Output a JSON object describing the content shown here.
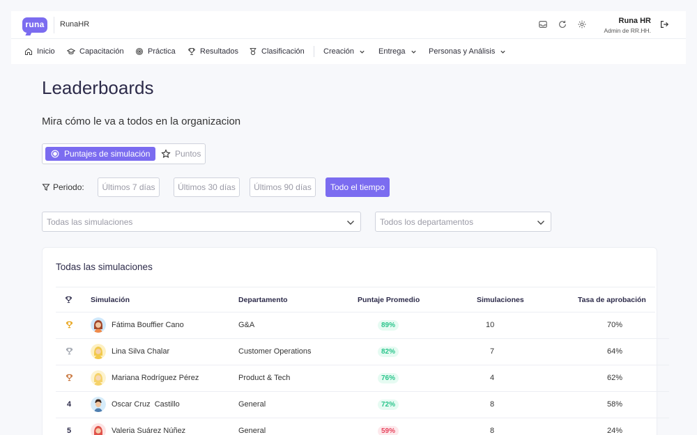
{
  "header": {
    "logo_text": "runa",
    "company": "RunaHR",
    "user_name": "Runa HR",
    "user_role": "Admin de RR.HH."
  },
  "nav": {
    "items": [
      {
        "label": "Inicio",
        "icon": "home-icon"
      },
      {
        "label": "Capacitación",
        "icon": "graduation-cap-icon"
      },
      {
        "label": "Práctica",
        "icon": "target-icon"
      },
      {
        "label": "Resultados",
        "icon": "trophy-icon"
      },
      {
        "label": "Clasificación",
        "icon": "medal-icon"
      },
      {
        "label": "Creación",
        "dropdown": true
      },
      {
        "label": "Entrega",
        "dropdown": true
      },
      {
        "label": "Personas y Análisis",
        "dropdown": true
      }
    ]
  },
  "page": {
    "title": "Leaderboards",
    "subtitle": "Mira cómo le va a todos en la organizacion"
  },
  "toggle": {
    "active": "Puntajes de simulación",
    "other": "Puntos"
  },
  "period": {
    "label": "Periodo:",
    "options": [
      "Últimos 7 días",
      "Últimos 30 días",
      "Últimos 90 días",
      "Todo el tiempo"
    ],
    "selected": "Todo el tiempo"
  },
  "filters": {
    "simulations_placeholder": "Todas las simulaciones",
    "departments_placeholder": "Todos los departamentos"
  },
  "table": {
    "title": "Todas las simulaciones",
    "columns": [
      "Simulación",
      "Departamento",
      "Puntaje Promedio",
      "Simulaciones",
      "Tasa de aprobación"
    ],
    "rows": [
      {
        "rank": "",
        "medal": "gold",
        "name": "Fátima Bouffier Cano",
        "department": "G&A",
        "score": "89%",
        "score_status": "good",
        "simulations": "10",
        "pass_rate": "70%"
      },
      {
        "rank": "",
        "medal": "silver",
        "name": "Lina Silva Chalar",
        "department": "Customer Operations",
        "score": "82%",
        "score_status": "good",
        "simulations": "7",
        "pass_rate": "64%"
      },
      {
        "rank": "",
        "medal": "bronze",
        "name": "Mariana Rodríguez Pérez",
        "department": "Product & Tech",
        "score": "76%",
        "score_status": "good",
        "simulations": "4",
        "pass_rate": "62%"
      },
      {
        "rank": "4",
        "medal": "",
        "name": "Oscar Cruz  Castillo",
        "department": "General",
        "score": "72%",
        "score_status": "good",
        "simulations": "8",
        "pass_rate": "58%"
      },
      {
        "rank": "5",
        "medal": "",
        "name": "Valeria Suárez Núñez",
        "department": "General",
        "score": "59%",
        "score_status": "bad",
        "simulations": "8",
        "pass_rate": "24%"
      }
    ]
  },
  "colors": {
    "accent": "#7b6cf0",
    "good": "#2ac48b",
    "bad": "#e7455f",
    "gold": "#e8a317",
    "silver": "#9ea3ad",
    "bronze": "#c8743a"
  }
}
